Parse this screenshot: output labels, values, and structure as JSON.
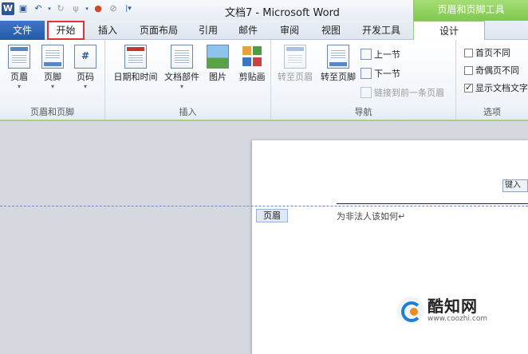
{
  "title_bar": {
    "app_logo": "W",
    "title": "文档7 - Microsoft Word",
    "context_group": "页眉和页脚工具",
    "qat_icons": [
      "save-icon",
      "undo-icon",
      "redo-icon",
      "format-painter-icon",
      "color-icon",
      "clear-icon",
      "customize-icon"
    ]
  },
  "tabs": [
    {
      "id": "file",
      "label": "文件"
    },
    {
      "id": "home",
      "label": "开始"
    },
    {
      "id": "insert",
      "label": "插入"
    },
    {
      "id": "layout",
      "label": "页面布局"
    },
    {
      "id": "references",
      "label": "引用"
    },
    {
      "id": "mailings",
      "label": "邮件"
    },
    {
      "id": "review",
      "label": "审阅"
    },
    {
      "id": "view",
      "label": "视图"
    },
    {
      "id": "developer",
      "label": "开发工具"
    },
    {
      "id": "design",
      "label": "设计"
    }
  ],
  "ribbon": {
    "header_footer": {
      "group_label": "页眉和页脚",
      "header": "页眉",
      "footer": "页脚",
      "page_number": "页码"
    },
    "insert": {
      "group_label": "插入",
      "date_time": "日期和时间",
      "doc_parts": "文档部件",
      "picture": "图片",
      "clip_art": "剪贴画"
    },
    "navigation": {
      "group_label": "导航",
      "goto_header": "转至页眉",
      "goto_footer": "转至页脚",
      "previous": "上一节",
      "next": "下一节",
      "link_previous": "链接到前一条页眉"
    },
    "options": {
      "group_label": "选项",
      "different_first": "首页不同",
      "different_odd_even": "奇偶页不同",
      "show_doc_text": "显示文档文字",
      "different_first_checked": false,
      "different_odd_even_checked": false,
      "show_doc_text_checked": true
    }
  },
  "document": {
    "header_tag": "页眉",
    "header_text": "为非法人该如何↵",
    "key_tag": "键入"
  },
  "watermark": {
    "name": "酷知网",
    "url": "www.coozhi.com"
  },
  "colors": {
    "file_tab": "#245aa6",
    "context_green": "#7fc84d",
    "highlight_red": "#d9343a"
  }
}
